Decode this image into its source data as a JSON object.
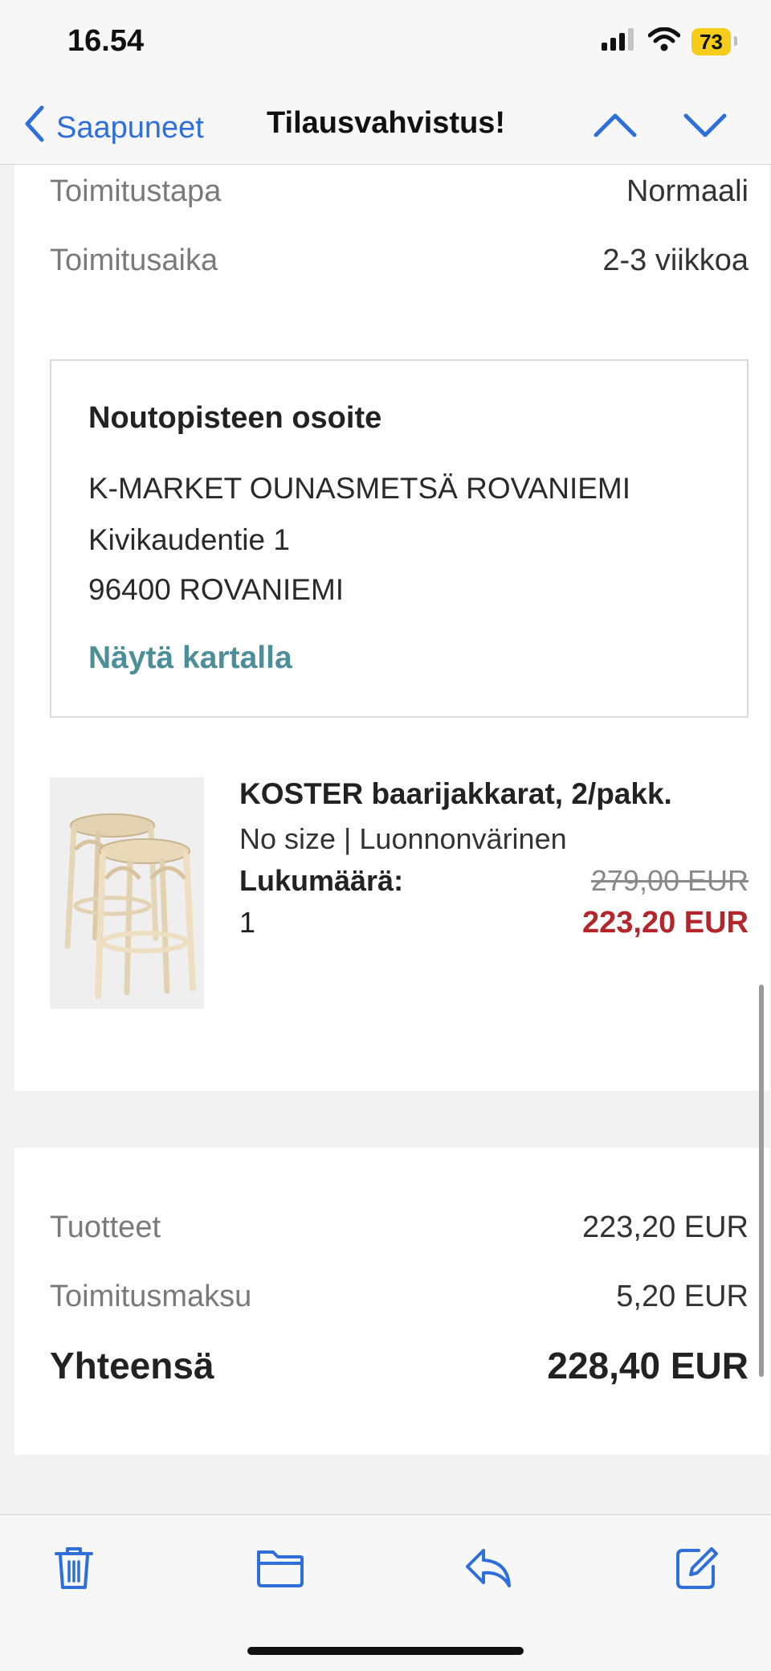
{
  "status_bar": {
    "time": "16.54",
    "battery": "73",
    "signal_icon": "cellular-signal-icon",
    "wifi_icon": "wifi-icon"
  },
  "nav": {
    "back_label": "Saapuneet",
    "title": "Tilausvahvistus!"
  },
  "delivery": {
    "method_label": "Toimitustapa",
    "method_value": "Normaali",
    "time_label": "Toimitusaika",
    "time_value": "2-3 viikkoa"
  },
  "pickup": {
    "title": "Noutopisteen osoite",
    "line1": "K-MARKET OUNASMETSÄ ROVANIEMI",
    "line2": "Kivikaudentie 1",
    "line3": "96400 ROVANIEMI",
    "map_link": "Näytä kartalla"
  },
  "product": {
    "name": "KOSTER baarijakkarat, 2/pakk.",
    "variant": "No size | Luonnonvärinen",
    "quantity_label": "Lukumäärä:",
    "quantity": "1",
    "original_price": "279,00 EUR",
    "price": "223,20 EUR"
  },
  "summary": {
    "products_label": "Tuotteet",
    "products_value": "223,20 EUR",
    "shipping_label": "Toimitusmaksu",
    "shipping_value": "5,20 EUR",
    "total_label": "Yhteensä",
    "total_value": "228,40 EUR"
  },
  "colors": {
    "accent_blue": "#2f6fdc",
    "link_teal": "#4d8f98",
    "sale_red": "#b3262b",
    "battery_yellow": "#f5cc1a"
  },
  "toolbar": {
    "icons": [
      "trash-icon",
      "folder-icon",
      "reply-icon",
      "compose-icon"
    ]
  }
}
